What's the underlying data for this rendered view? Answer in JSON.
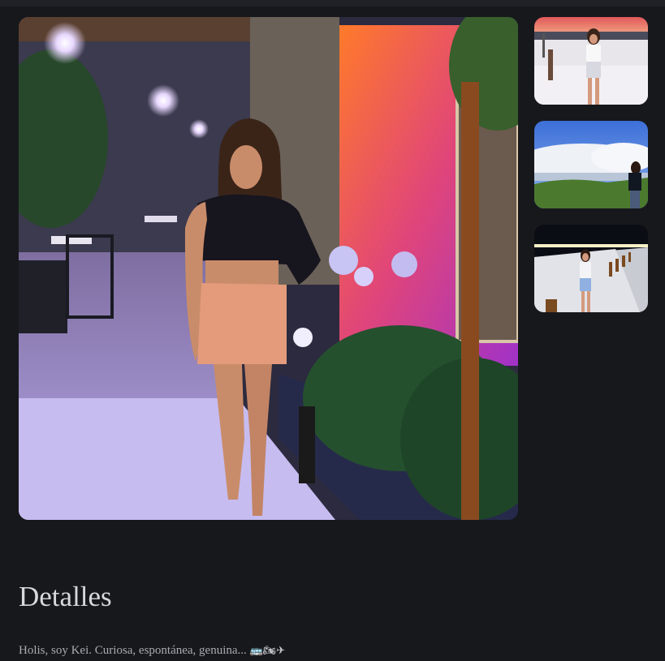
{
  "gallery": {
    "main_photo": {
      "description": "main-photo"
    },
    "thumbnails": [
      {
        "name": "thumbnail-beach-sunset"
      },
      {
        "name": "thumbnail-mountain-clouds"
      },
      {
        "name": "thumbnail-promenade-night"
      }
    ]
  },
  "details": {
    "title": "Detalles",
    "bio": "Holis, soy Kei. Curiosa, espontánea, genuina...",
    "bio_emojis": "🚌🏍✈"
  },
  "colors": {
    "background": "#17181c",
    "title": "#d7d8dc",
    "body_text": "#a9abb2"
  }
}
